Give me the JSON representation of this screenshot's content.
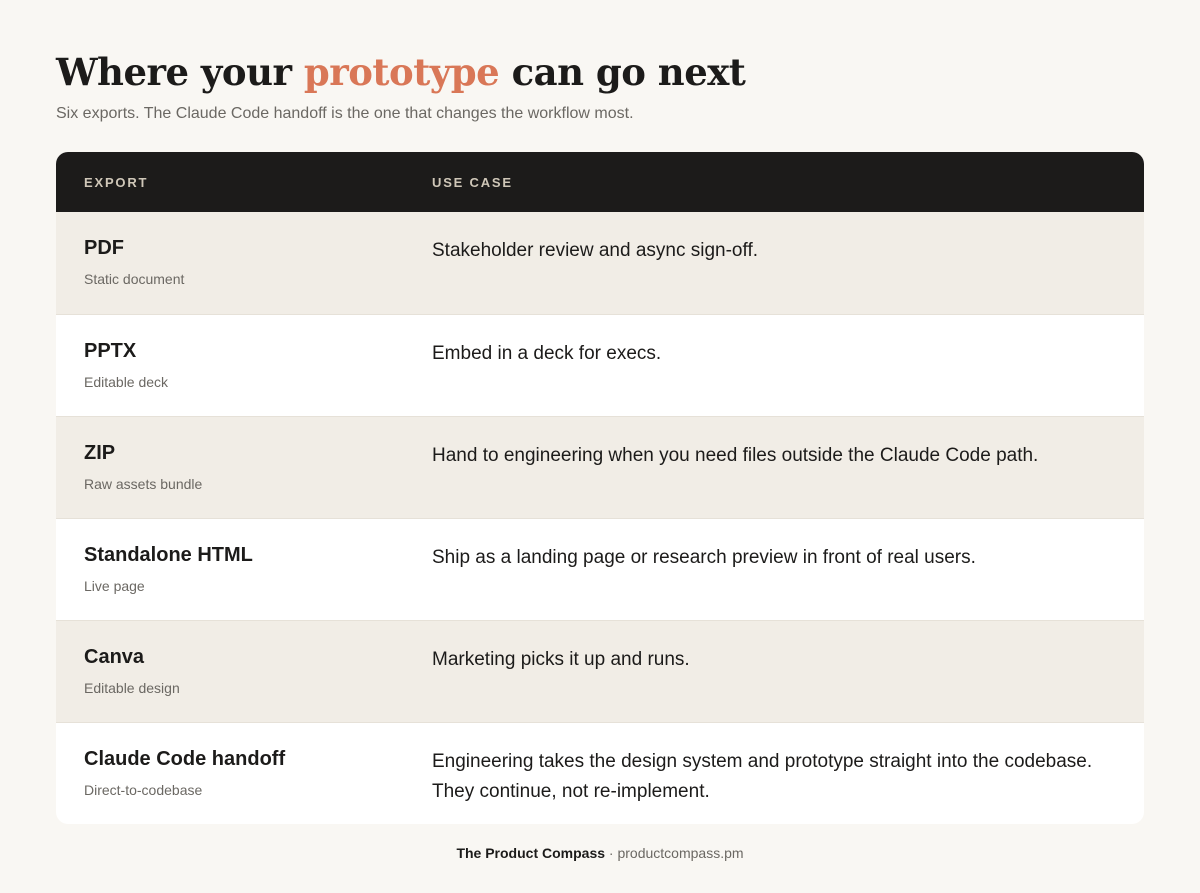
{
  "header": {
    "title_before": "Where your ",
    "title_accent": "prototype",
    "title_after": " can go next",
    "subtitle": "Six exports. The Claude Code handoff is the one that changes the workflow most."
  },
  "colors": {
    "accent": "#d97757",
    "header_bg": "#1c1b1a",
    "alt_row_bg": "#f1ede6",
    "page_bg": "#f9f7f3"
  },
  "table": {
    "columns": [
      "EXPORT",
      "USE CASE"
    ],
    "rows": [
      {
        "name": "PDF",
        "sub": "Static document",
        "use": "Stakeholder review and async sign-off."
      },
      {
        "name": "PPTX",
        "sub": "Editable deck",
        "use": "Embed in a deck for execs."
      },
      {
        "name": "ZIP",
        "sub": "Raw assets bundle",
        "use": "Hand to engineering when you need files outside the Claude Code path."
      },
      {
        "name": "Standalone HTML",
        "sub": "Live page",
        "use": "Ship as a landing page or research preview in front of real users."
      },
      {
        "name": "Canva",
        "sub": "Editable design",
        "use": "Marketing picks it up and runs."
      },
      {
        "name": "Claude Code handoff",
        "sub": "Direct-to-codebase",
        "use": "Engineering takes the design system and prototype straight into the codebase. They continue, not re-implement."
      }
    ]
  },
  "footer": {
    "brand": "The Product Compass",
    "separator": " · ",
    "site": "productcompass.pm"
  }
}
